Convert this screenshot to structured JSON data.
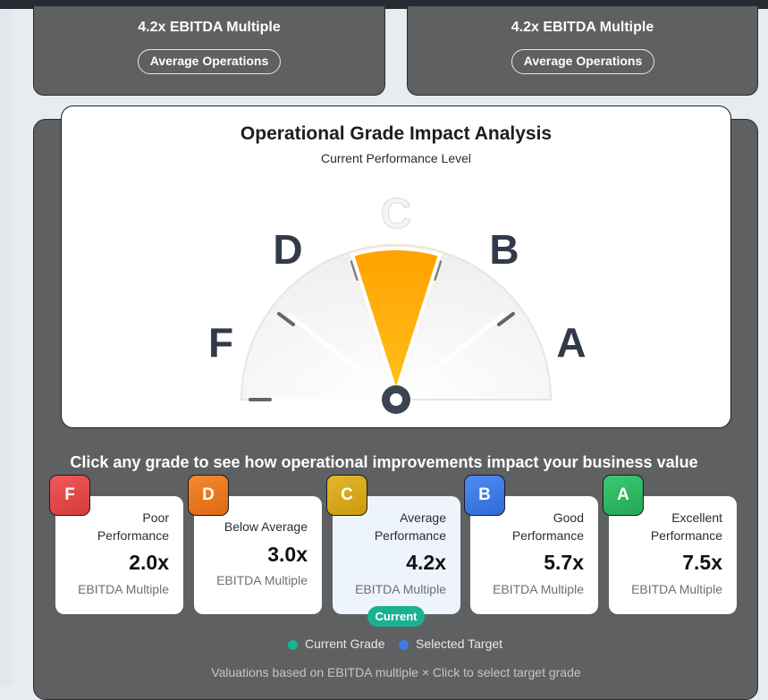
{
  "top_cards": [
    {
      "multiple": "4.2x EBITDA Multiple",
      "pill": "Average Operations"
    },
    {
      "multiple": "4.2x EBITDA Multiple",
      "pill": "Average Operations"
    }
  ],
  "gauge": {
    "title": "Operational Grade Impact Analysis",
    "subtitle": "Current Performance Level",
    "labels": {
      "F": "F",
      "D": "D",
      "C": "C",
      "B": "B",
      "A": "A"
    },
    "active_grade": "C",
    "colors": {
      "needle": "#ffa600",
      "active_label": "#f4f4f4",
      "label": "#323a4a"
    }
  },
  "instructions": "Click any grade to see how operational improvements impact your business value",
  "grades": [
    {
      "letter": "F",
      "label": "Poor Performance",
      "value": "2.0x",
      "unit": "EBITDA Multiple",
      "color": "#e04848"
    },
    {
      "letter": "D",
      "label": "Below Average",
      "value": "3.0x",
      "unit": "EBITDA Multiple",
      "color": "#e8731c"
    },
    {
      "letter": "C",
      "label": "Average Performance",
      "value": "4.2x",
      "unit": "EBITDA Multiple",
      "color": "#d4a515",
      "current": true
    },
    {
      "letter": "B",
      "label": "Good Performance",
      "value": "5.7x",
      "unit": "EBITDA Multiple",
      "color": "#3e7be6"
    },
    {
      "letter": "A",
      "label": "Excellent Performance",
      "value": "7.5x",
      "unit": "EBITDA Multiple",
      "color": "#2db860"
    }
  ],
  "current_badge": "Current",
  "legend": [
    {
      "label": "Current Grade",
      "color": "#18b293"
    },
    {
      "label": "Selected Target",
      "color": "#3e7be6"
    }
  ],
  "footnote": "Valuations based on EBITDA multiple × Click to select target grade"
}
